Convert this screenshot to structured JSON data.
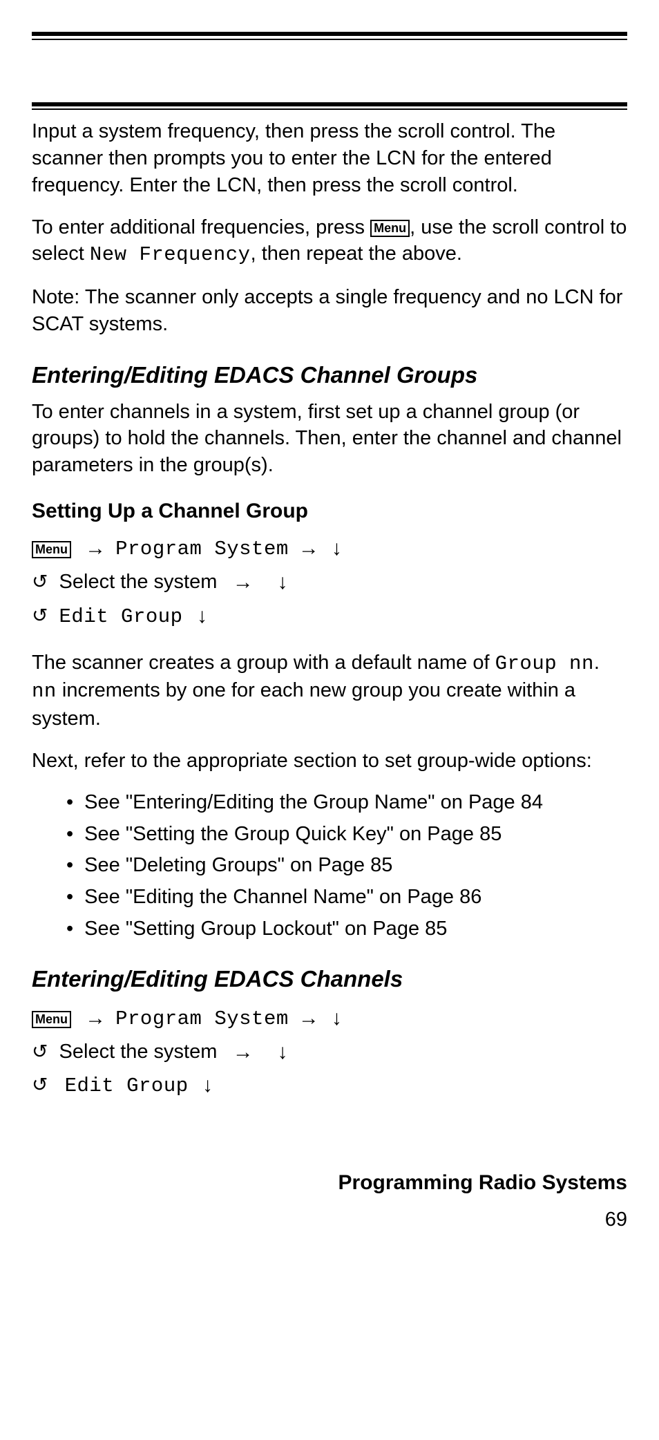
{
  "menu_label": "Menu",
  "intro1": "Input a system frequency, then press the scroll control. The scanner then prompts you to enter the LCN for the entered frequency. Enter the LCN, then press the scroll control.",
  "intro2_a": "To enter additional frequencies, press ",
  "intro2_b": ", use the scroll control to select ",
  "intro2_code": "New Frequency",
  "intro2_c": ", then repeat the above.",
  "note": "Note: The scanner only accepts a single frequency and no LCN for SCAT systems.",
  "h2_groups": "Entering/Editing EDACS Channel Groups",
  "groups_intro": "To enter channels in a system, first set up a channel group (or groups) to hold the channels. Then, enter the channel and channel parameters in the group(s).",
  "h3_setup": "Setting Up a Channel Group",
  "nav1": {
    "line1_code": "Program System",
    "line2_text": "Select the system",
    "line3_code": "Edit Group"
  },
  "after_nav1_a": "The scanner creates a group with a default name of ",
  "after_nav1_code1": "Group nn",
  "after_nav1_b": ". ",
  "after_nav1_code2": "nn",
  "after_nav1_c": " increments by one for each new group you create within a system.",
  "next_ref": "Next, refer to the appropriate section to set group-wide options:",
  "refs": [
    "See \"Entering/Editing the Group Name\" on Page 84",
    "See \"Setting the Group Quick Key\" on Page 85",
    "See \"Deleting Groups\" on Page 85",
    "See \"Editing the Channel Name\" on Page 86",
    "See \"Setting Group Lockout\" on Page 85"
  ],
  "h2_channels": "Entering/Editing EDACS Channels",
  "nav2": {
    "line1_code": "Program System",
    "line2_text": "Select the system",
    "line3_code": "Edit Group"
  },
  "footer_title": "Programming Radio Systems",
  "page_number": "69"
}
